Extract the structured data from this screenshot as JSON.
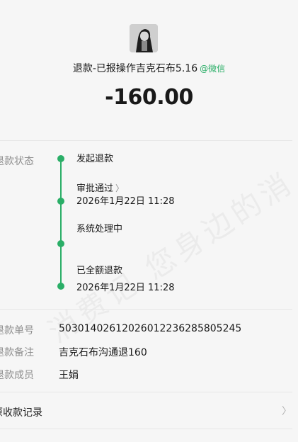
{
  "header": {
    "title": "退款-已报操作吉克石布5.16",
    "source_label": "微信",
    "amount": "-160.00"
  },
  "status": {
    "label": "退款状态",
    "steps": [
      {
        "title": "发起退款",
        "time": ""
      },
      {
        "title": "审批通过",
        "time": "2026年1月22日 11:28"
      },
      {
        "title": "系统处理中",
        "time": ""
      },
      {
        "title": "已全额退款",
        "time": "2026年1月22日 11:28"
      }
    ]
  },
  "details": [
    {
      "label": "退款单号",
      "value": "50301402612026012236285805245"
    },
    {
      "label": "退款备注",
      "value": "吉克石布沟通退160"
    },
    {
      "label": "退款成员",
      "value": "王娟"
    }
  ],
  "record_link": "原收款记录",
  "watermark": "消费记 您身边的消",
  "colors": {
    "accent": "#2aae67",
    "text": "#191919",
    "muted": "#8f8f8f",
    "background": "#f6f6f6"
  }
}
